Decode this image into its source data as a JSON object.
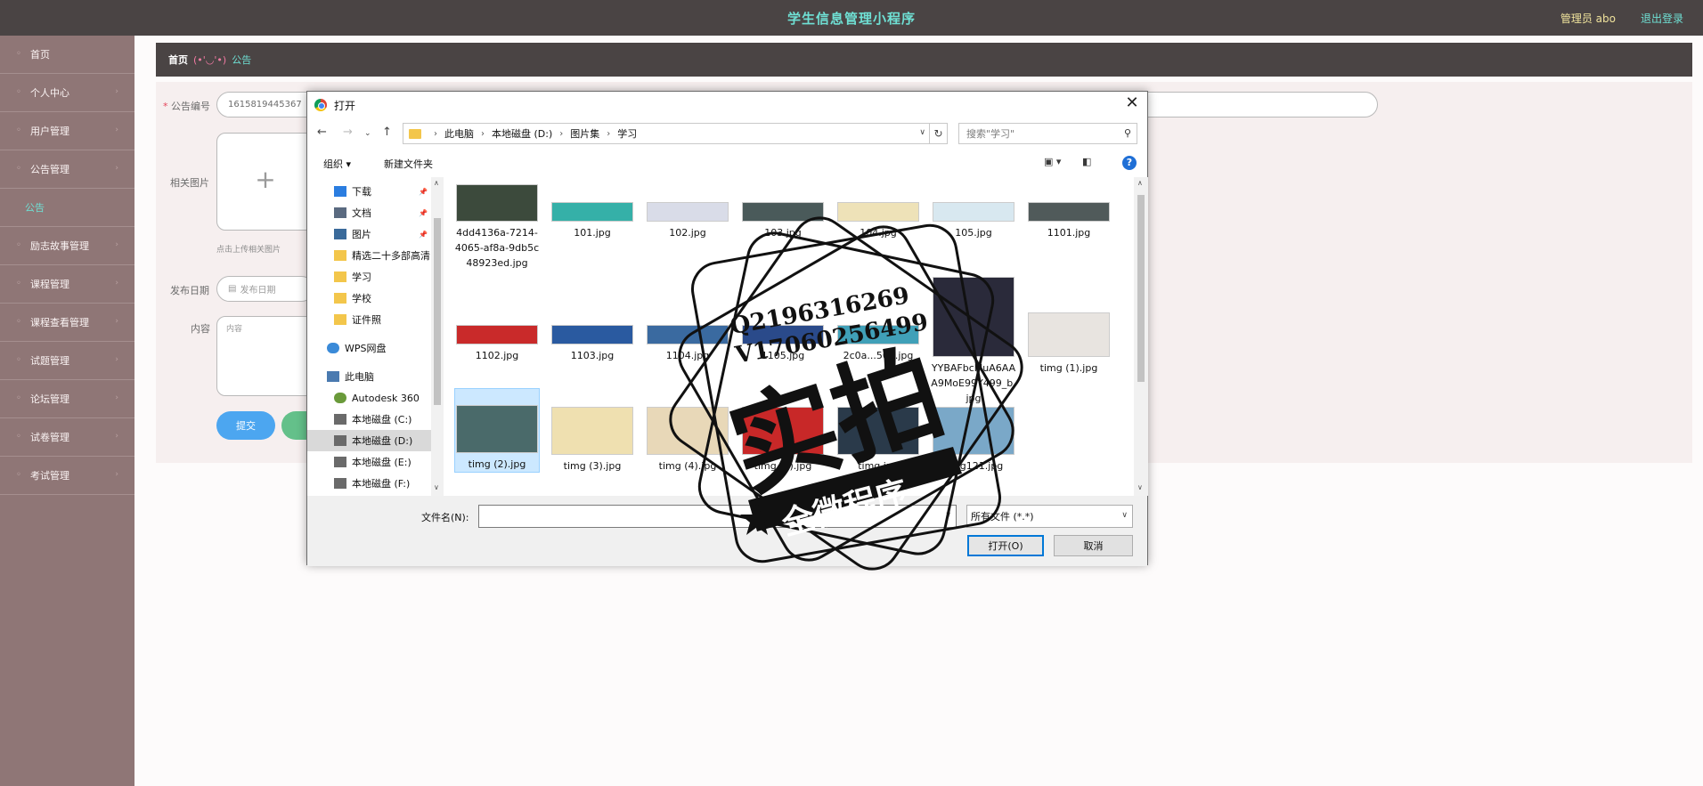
{
  "app": {
    "title": "学生信息管理小程序",
    "admin_label": "管理员 abo",
    "logout_label": "退出登录"
  },
  "sidebar": {
    "items": [
      {
        "label": "首页",
        "icon": "home-icon"
      },
      {
        "label": "个人中心",
        "icon": "user-icon"
      },
      {
        "label": "用户管理",
        "icon": "users-icon"
      },
      {
        "label": "公告管理",
        "icon": "notice-icon"
      },
      {
        "label": "公告",
        "sub": true
      },
      {
        "label": "励志故事管理",
        "icon": "story-icon"
      },
      {
        "label": "课程管理",
        "icon": "course-icon"
      },
      {
        "label": "课程查看管理",
        "icon": "view-icon"
      },
      {
        "label": "试题管理",
        "icon": "question-icon"
      },
      {
        "label": "论坛管理",
        "icon": "forum-icon"
      },
      {
        "label": "试卷管理",
        "icon": "paper-icon"
      },
      {
        "label": "考试管理",
        "icon": "exam-icon"
      }
    ]
  },
  "breadcrumb": {
    "home": "首页",
    "face": "(•'◡'•)",
    "current": "公告"
  },
  "form": {
    "id_label": "公告编号",
    "id_value": "1615819445367",
    "image_label": "相关图片",
    "upload_hint": "点击上传相关图片",
    "date_label": "发布日期",
    "date_placeholder": "发布日期",
    "content_label": "内容",
    "content_placeholder": "内容",
    "submit_label": "提交"
  },
  "dialog": {
    "title": "打开",
    "path": [
      "此电脑",
      "本地磁盘 (D:)",
      "图片集",
      "学习"
    ],
    "search_placeholder": "搜索\"学习\"",
    "organize_label": "组织 ▾",
    "new_folder_label": "新建文件夹",
    "nav_items": [
      {
        "label": "下载",
        "pinned": true,
        "kind": "download"
      },
      {
        "label": "文档",
        "pinned": true,
        "kind": "doc"
      },
      {
        "label": "图片",
        "pinned": true,
        "kind": "pic"
      },
      {
        "label": "精选二十多部高清",
        "kind": "folder"
      },
      {
        "label": "学习",
        "kind": "folder"
      },
      {
        "label": "学校",
        "kind": "folder"
      },
      {
        "label": "证件照",
        "kind": "folder"
      },
      {
        "label": "WPS网盘",
        "kind": "cloud"
      },
      {
        "label": "此电脑",
        "kind": "pc"
      },
      {
        "label": "Autodesk 360",
        "kind": "cloud2"
      },
      {
        "label": "本地磁盘 (C:)",
        "kind": "drive"
      },
      {
        "label": "本地磁盘 (D:)",
        "kind": "drive",
        "selected": true
      },
      {
        "label": "本地磁盘 (E:)",
        "kind": "drive"
      },
      {
        "label": "本地磁盘 (F:)",
        "kind": "drive"
      }
    ],
    "files": [
      {
        "name": "4dd4136a-7214-4065-af8a-9db5c48923ed.jpg",
        "color": "#3c4a3c"
      },
      {
        "name": "101.jpg",
        "color": "#35b0a8"
      },
      {
        "name": "102.jpg",
        "color": "#d9dce8"
      },
      {
        "name": "103.jpg",
        "color": "#4a5a5a"
      },
      {
        "name": "104.jpg",
        "color": "#eee2b8"
      },
      {
        "name": "105.jpg",
        "color": "#d8e8f0"
      },
      {
        "name": "1101.jpg",
        "color": "#505a5a"
      },
      {
        "name": "1102.jpg",
        "color": "#c92a2a"
      },
      {
        "name": "1103.jpg",
        "color": "#2a5aa0"
      },
      {
        "name": "1104.jpg",
        "color": "#3a6aa0"
      },
      {
        "name": "1105.jpg",
        "color": "#2a4a8a"
      },
      {
        "name": "2c0a...50b.jpg",
        "color": "#40a0b8"
      },
      {
        "name": "YYBAFbcMuA6AAA9MoE99Y499_b.jpg",
        "color": "#2a2a3a"
      },
      {
        "name": "timg (1).jpg",
        "color": "#e8e4e0"
      },
      {
        "name": "timg (2).jpg",
        "color": "#4a6a6a",
        "selected": true
      },
      {
        "name": "timg (3).jpg",
        "color": "#efe0b0"
      },
      {
        "name": "timg (4).jpg",
        "color": "#e8d8b8"
      },
      {
        "name": "timg (5).jpg",
        "color": "#c82828"
      },
      {
        "name": "timg.jpg",
        "color": "#2a3a4a"
      },
      {
        "name": "timg121.jpg",
        "color": "#7aa8c8"
      }
    ],
    "filename_label": "文件名(N):",
    "filename_value": "",
    "filetype_value": "所有文件 (*.*)",
    "open_label": "打开(O)",
    "cancel_label": "取消"
  },
  "watermark": {
    "line1": "Q2196316269",
    "line2": "V17060256499",
    "big": "实拍",
    "banner": "全微程序"
  }
}
